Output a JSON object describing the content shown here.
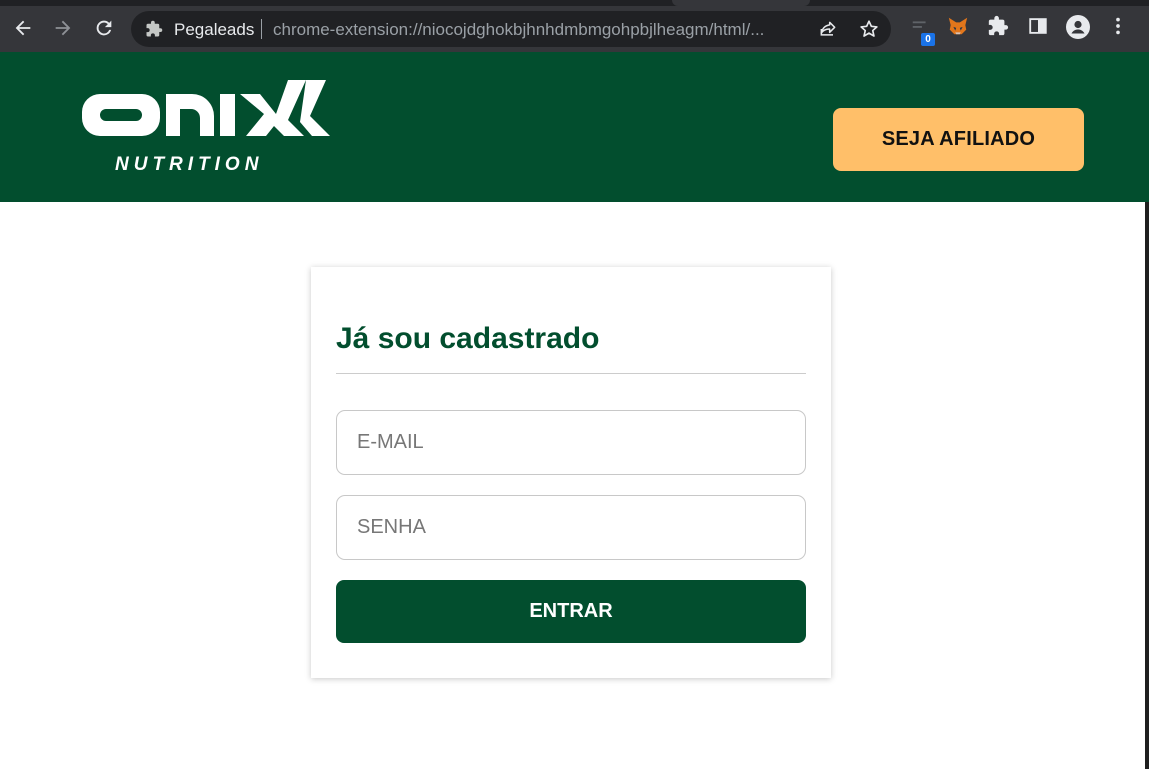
{
  "browser": {
    "site_name": "Pegaleads",
    "url": "chrome-extension://niocojdghokbjhnhdmbmgohpbjlheagm/html/...",
    "extension_badge_count": "0",
    "icons": [
      "back-icon",
      "forward-icon",
      "reload-icon",
      "puzzle-icon",
      "share-icon",
      "star-icon",
      "extension-icon",
      "metamask-fox-icon",
      "extensions-puzzle-icon",
      "side-panel-icon",
      "profile-icon",
      "menu-kebab-icon"
    ]
  },
  "header": {
    "logo_main": "ONIX",
    "logo_sub": "NUTRITION",
    "cta_label": "SEJA AFILIADO",
    "background": "#024e2e",
    "cta_color": "#ffbf69"
  },
  "login": {
    "title": "Já sou cadastrado",
    "email_placeholder": "E-MAIL",
    "password_placeholder": "SENHA",
    "submit_label": "ENTRAR",
    "accent": "#024e2e"
  }
}
